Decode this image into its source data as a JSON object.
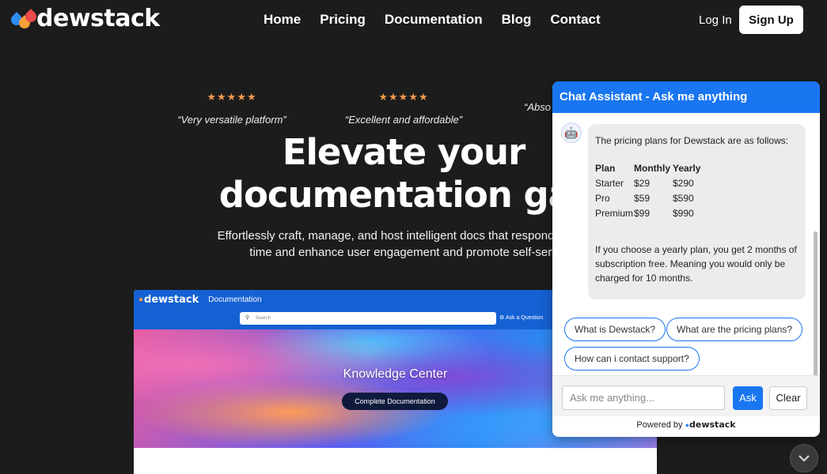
{
  "nav": {
    "logo_text": "dewstack",
    "links": [
      "Home",
      "Pricing",
      "Documentation",
      "Blog",
      "Contact"
    ],
    "login_label": "Log In",
    "signup_label": "Sign Up"
  },
  "hero": {
    "reviews": [
      {
        "stars": "★★★★★",
        "quote": "“Very versatile platform”"
      },
      {
        "stars": "★★★★★",
        "quote": "“Excellent and affordable”"
      },
      {
        "stars": "",
        "quote": "“Abso"
      }
    ],
    "title_line1": "Elevate your",
    "title_line2": "documentation gar",
    "subtitle_line1": "Effortlessly craft, manage, and host intelligent docs that respond to use",
    "subtitle_line2": "time and enhance user engagement and promote self-serv"
  },
  "preview": {
    "logo_text": "dewstack",
    "section_label": "Documentation",
    "search_placeholder": "Search",
    "ask_label": "Ask a Question",
    "hero_title": "Knowledge Center",
    "hero_button": "Complete Documentation"
  },
  "chat": {
    "header": "Chat Assistant - Ask me anything",
    "message_intro": "The pricing plans for Dewstack are as follows:",
    "plans_header": [
      "Plan",
      "Monthly",
      "Yearly"
    ],
    "plans": [
      [
        "Starter",
        "$29",
        "$290"
      ],
      [
        "Pro",
        "$59",
        "$590"
      ],
      [
        "Premium",
        "$99",
        "$990"
      ]
    ],
    "message_footer": "If you choose a yearly plan, you get 2 months of subscription free. Meaning you would only be charged for 10 months.",
    "suggestions": [
      "What is Dewstack?",
      "What are the pricing plans?",
      "How can i contact support?"
    ],
    "input_placeholder": "Ask me anything...",
    "ask_label": "Ask",
    "clear_label": "Clear",
    "powered_by": "Powered by",
    "powered_brand": "dewstack"
  },
  "colors": {
    "accent": "#1976f0",
    "background": "#1c1c1c",
    "star": "#f2994a"
  }
}
